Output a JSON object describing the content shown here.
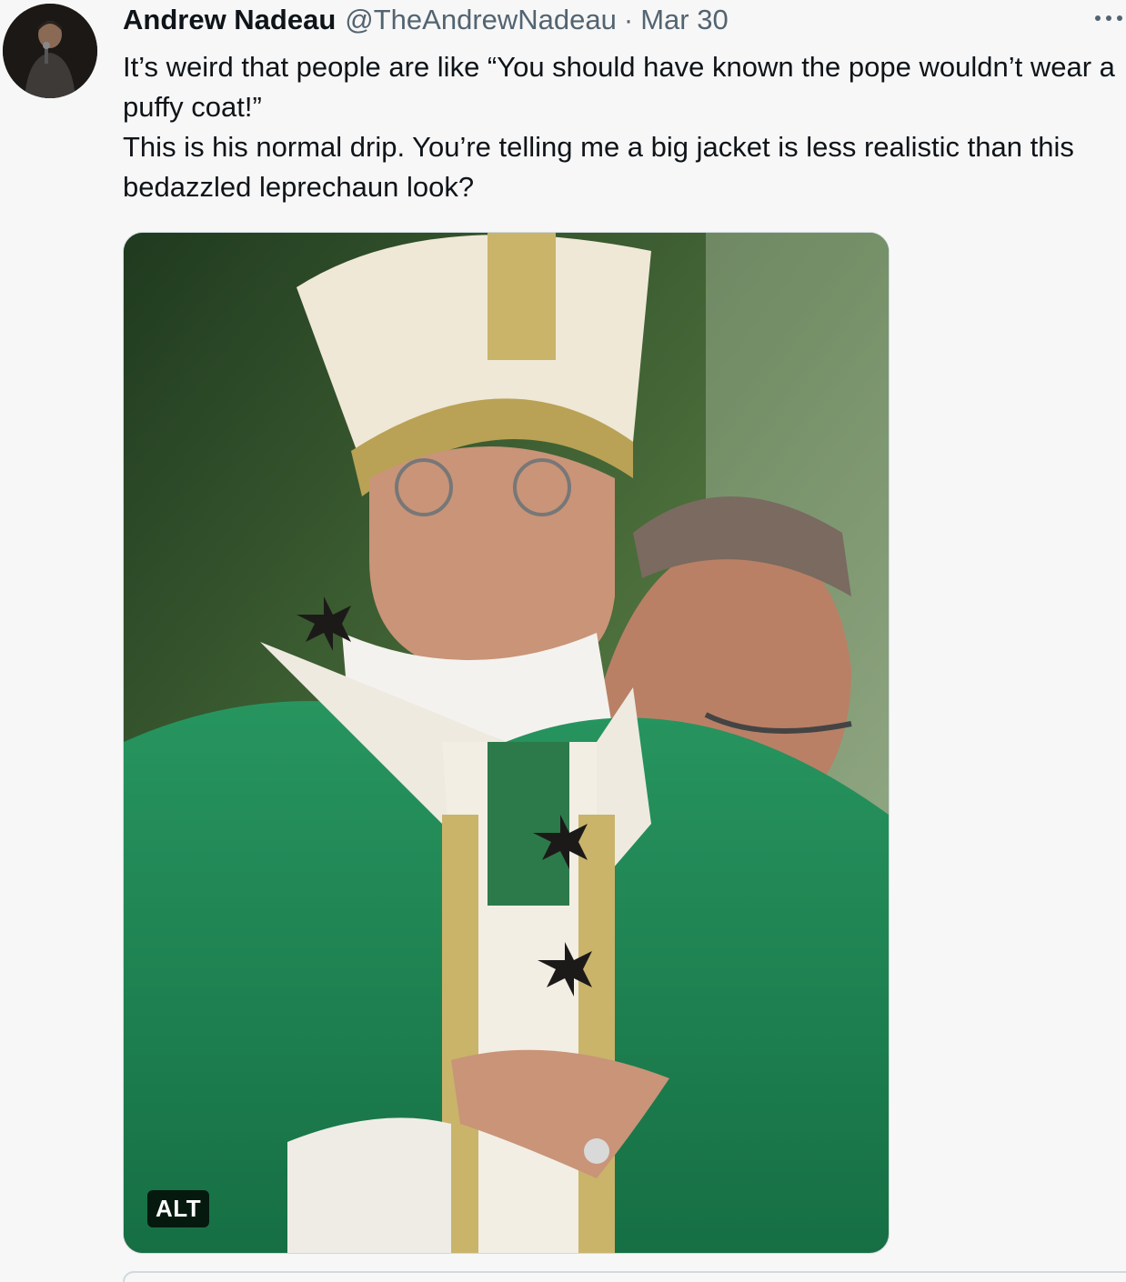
{
  "tweet": {
    "author_name": "Andrew Nadeau",
    "handle": "@TheAndrewNadeau",
    "separator": "·",
    "date": "Mar 30",
    "more_icon": "more-horizontal-icon",
    "text_lines": [
      "It’s weird that people are like “You should have known the pope wouldn’t wear a puffy coat!”",
      "This is his normal drip. You’re telling me a big jacket is less realistic than this bedazzled leprechaun look?"
    ],
    "media": {
      "alt_label": "ALT"
    }
  },
  "colors": {
    "background": "#f7f7f7",
    "text_primary": "#0f1419",
    "text_secondary": "#536471",
    "border": "#cfd9de",
    "vestment_green": "#1e8a57",
    "vestment_gold": "#c9b46a"
  }
}
